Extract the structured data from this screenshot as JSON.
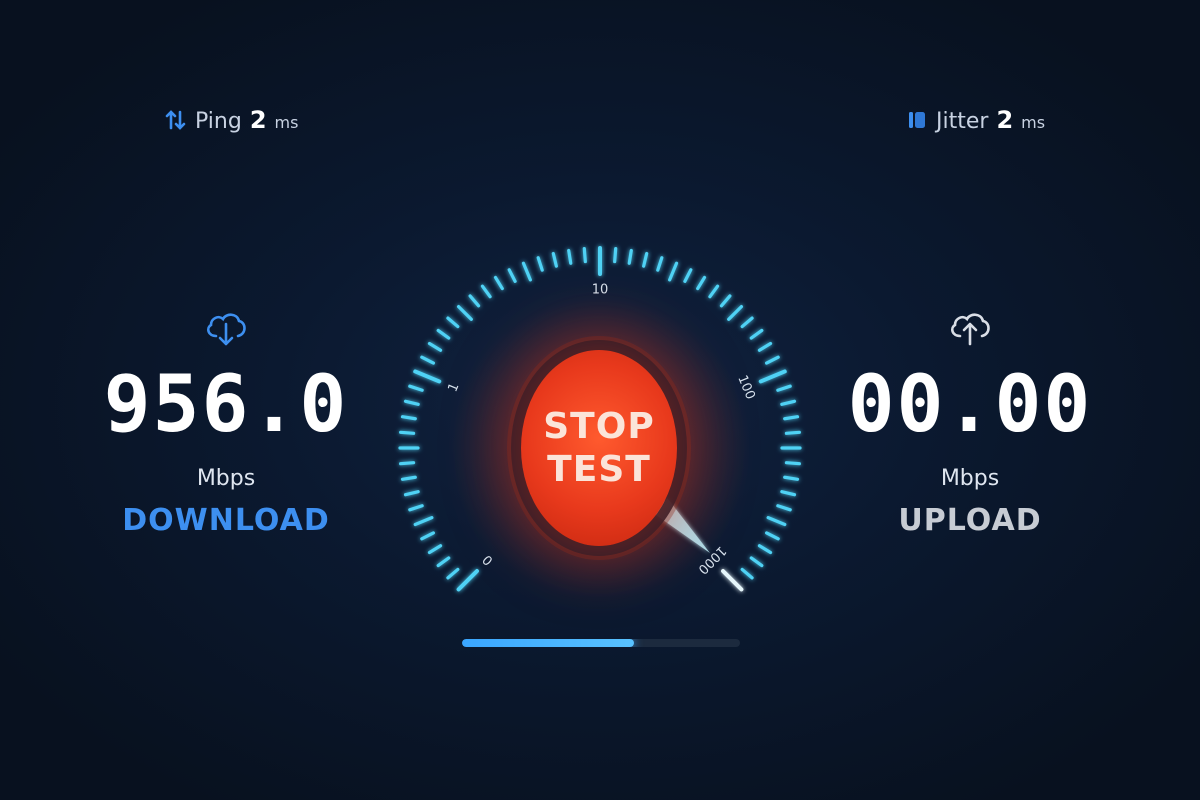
{
  "colors": {
    "accent": "#3d8ff0",
    "gauge_tick": "#4fd2f5",
    "button": "#e8391c",
    "upload_label": "#c7ccd4"
  },
  "ping": {
    "icon": "ping-arrows-icon",
    "label": "Ping",
    "value": "2",
    "unit": "ms"
  },
  "jitter": {
    "icon": "jitter-icon",
    "label": "Jitter",
    "value": "2",
    "unit": "ms"
  },
  "download": {
    "icon": "cloud-download-icon",
    "value": "956.0",
    "unit": "Mbps",
    "label": "DOWNLOAD"
  },
  "upload": {
    "icon": "cloud-upload-icon",
    "value": "00.00",
    "unit": "Mbps",
    "label": "UPLOAD"
  },
  "gauge": {
    "scale_labels": [
      "0",
      "1",
      "10",
      "100",
      "1000"
    ],
    "needle_value": 956.0
  },
  "stop_button": {
    "line1": "STOP",
    "line2": "TEST"
  },
  "progress": {
    "fraction": 0.62
  }
}
